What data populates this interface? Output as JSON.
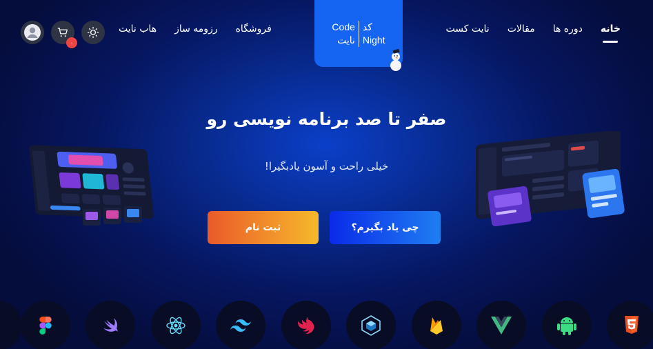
{
  "nav": {
    "links": [
      "خانه",
      "دوره ها",
      "مقالات",
      "نایت کست"
    ],
    "left_links": [
      "فروشگاه",
      "رزومه ساز",
      "هاب نایت"
    ],
    "active": "خانه"
  },
  "logo": {
    "code": "Code",
    "night": "Night",
    "fa_top": "کد",
    "fa_bottom": "نایت"
  },
  "cart": {
    "badge": "۰"
  },
  "hero": {
    "title": "صفر تا صد برنامه نویسی رو",
    "subtitle": "خیلی راحت و آسون یادبگیرا!",
    "learn_button": "چی یاد بگیرم؟",
    "signup_button": "ثبت نام"
  },
  "tech_icons": [
    "figma-icon",
    "swift-icon",
    "react-icon",
    "tailwind-icon",
    "nestjs-icon",
    "webpack-icon",
    "firebase-icon",
    "vue-icon",
    "android-icon",
    "html5-icon"
  ],
  "colors": {
    "accent": "#1565f2",
    "badge": "#ef4444",
    "signup_from": "#ea5a2a",
    "signup_to": "#f6b92b"
  }
}
